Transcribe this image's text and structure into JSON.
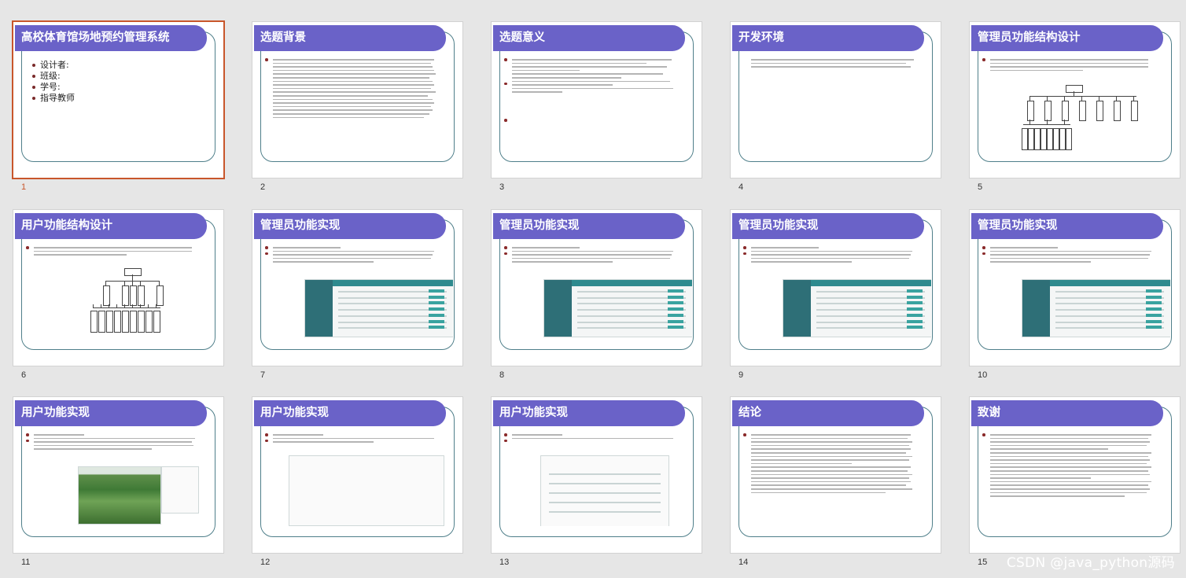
{
  "slides": [
    {
      "num": "1",
      "title": "高校体育馆场地预约管理系统",
      "body": [
        "设计者:",
        "班级:",
        "学号:",
        "指导教师"
      ]
    },
    {
      "num": "2",
      "title": "选题背景"
    },
    {
      "num": "3",
      "title": "选题意义"
    },
    {
      "num": "4",
      "title": "开发环境"
    },
    {
      "num": "5",
      "title": "管理员功能结构设计"
    },
    {
      "num": "6",
      "title": "用户功能结构设计"
    },
    {
      "num": "7",
      "title": "管理员功能实现"
    },
    {
      "num": "8",
      "title": "管理员功能实现"
    },
    {
      "num": "9",
      "title": "管理员功能实现"
    },
    {
      "num": "10",
      "title": "管理员功能实现"
    },
    {
      "num": "11",
      "title": "用户功能实现"
    },
    {
      "num": "12",
      "title": "用户功能实现"
    },
    {
      "num": "13",
      "title": "用户功能实现"
    },
    {
      "num": "14",
      "title": "结论"
    },
    {
      "num": "15",
      "title": "致谢"
    }
  ],
  "watermark": "CSDN @java_python源码",
  "colors": {
    "title_bar": "#6a62c8",
    "frame": "#4f7f8a",
    "selected": "#c8562b",
    "background": "#e6e6e6"
  }
}
